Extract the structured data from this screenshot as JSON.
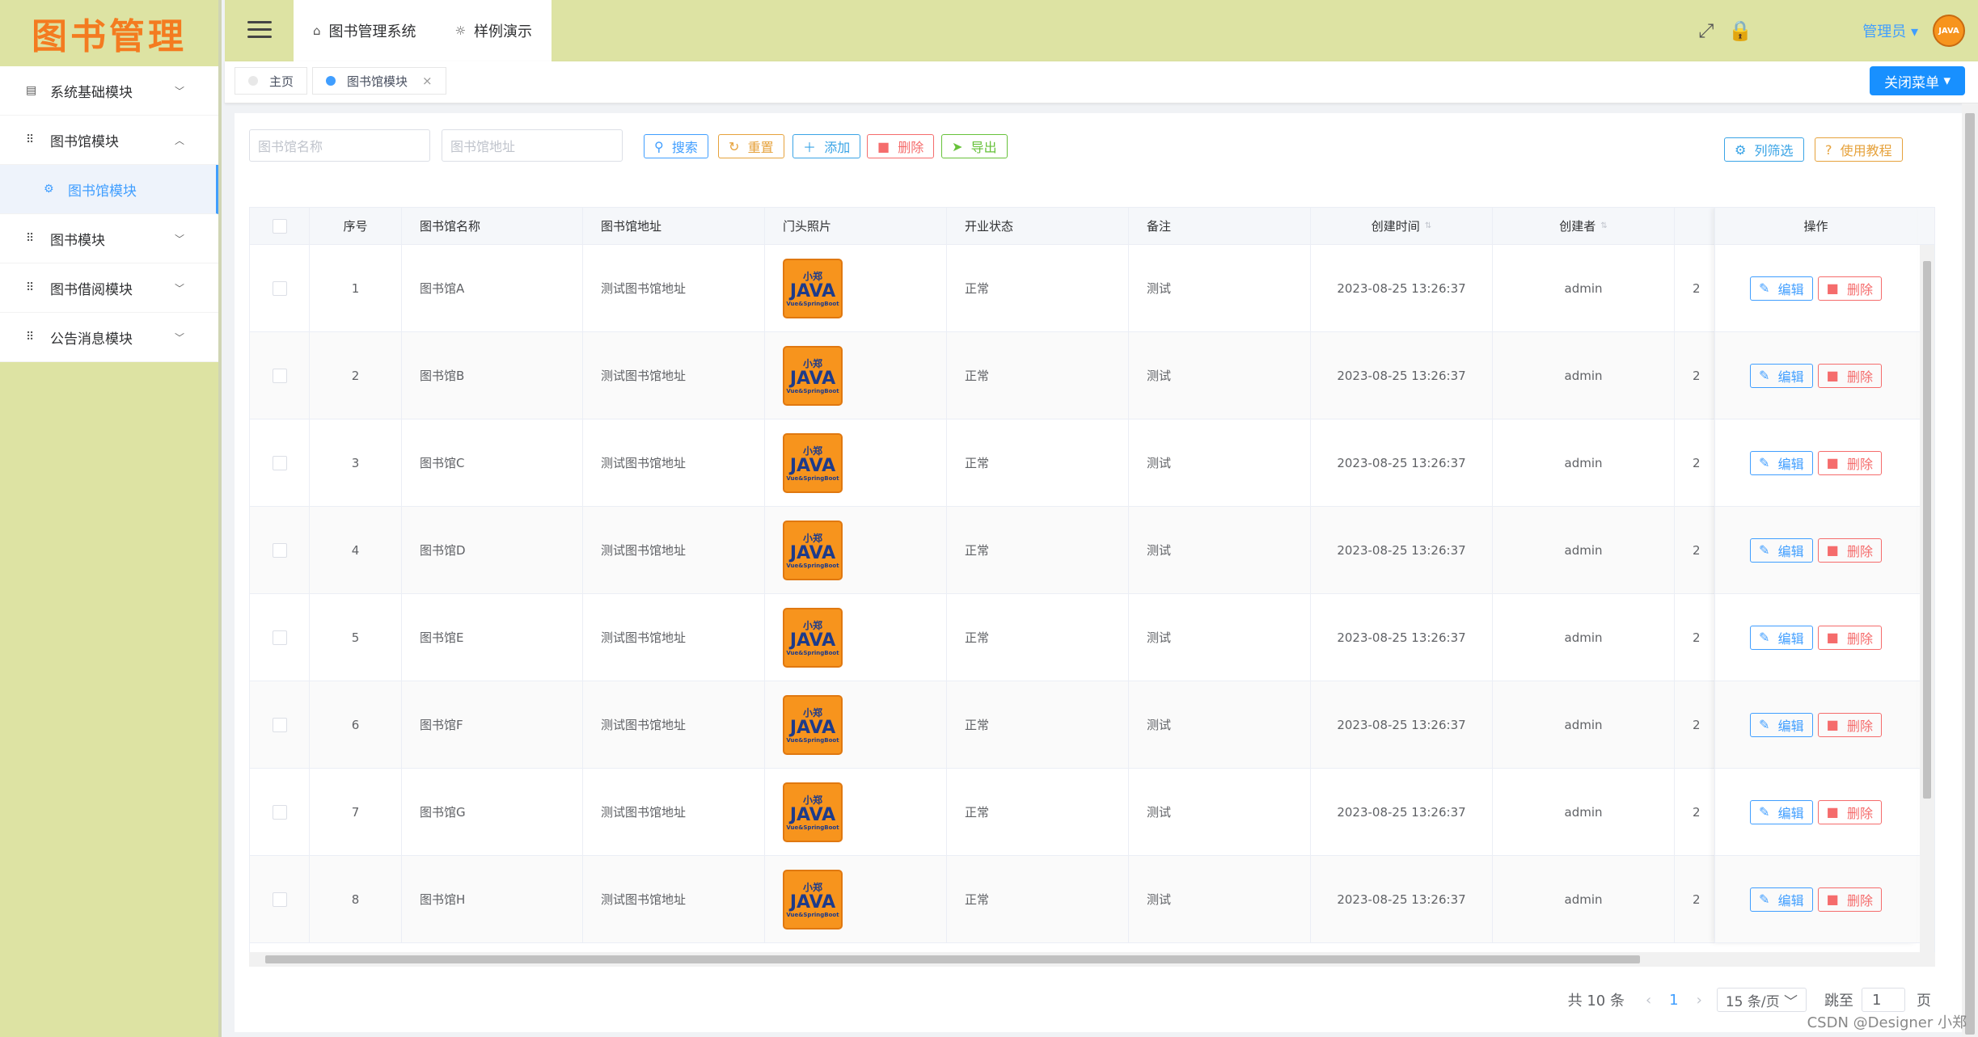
{
  "sidebar": {
    "logo": "图书管理",
    "menu": [
      {
        "label": "系统基础模块",
        "icon": "chart-icon",
        "expanded": false
      },
      {
        "label": "图书馆模块",
        "icon": "grid-icon",
        "expanded": true
      },
      {
        "label": "图书馆模块",
        "icon": "settings-icon",
        "submenu": true
      },
      {
        "label": "图书模块",
        "icon": "grid-icon",
        "expanded": false
      },
      {
        "label": "图书借阅模块",
        "icon": "grid-icon",
        "expanded": false
      },
      {
        "label": "公告消息模块",
        "icon": "grid-icon",
        "expanded": false
      }
    ]
  },
  "header": {
    "tabs": [
      {
        "label": "图书管理系统",
        "icon": "home-icon"
      },
      {
        "label": "样例演示",
        "icon": "sun-icon"
      }
    ],
    "user": "管理员"
  },
  "tags": {
    "items": [
      {
        "label": "主页"
      },
      {
        "label": "图书馆模块",
        "close": "×"
      }
    ],
    "close_menu": "关闭菜单"
  },
  "toolbar": {
    "name_placeholder": "图书馆名称",
    "address_placeholder": "图书馆地址",
    "search": "搜索",
    "reset": "重置",
    "add": "添加",
    "delete": "删除",
    "export": "导出",
    "columns": "列筛选",
    "tutorial": "使用教程"
  },
  "table": {
    "headers": [
      "序号",
      "图书馆名称",
      "图书馆地址",
      "门头照片",
      "开业状态",
      "备注",
      "创建时间",
      "创建者",
      "操作"
    ],
    "rows": [
      {
        "no": "1",
        "name": "图书馆A",
        "address": "测试图书馆地址",
        "status": "正常",
        "remark": "测试",
        "created": "2023-08-25 13:26:37",
        "creator": "admin",
        "extra": "2"
      },
      {
        "no": "2",
        "name": "图书馆B",
        "address": "测试图书馆地址",
        "status": "正常",
        "remark": "测试",
        "created": "2023-08-25 13:26:37",
        "creator": "admin",
        "extra": "2"
      },
      {
        "no": "3",
        "name": "图书馆C",
        "address": "测试图书馆地址",
        "status": "正常",
        "remark": "测试",
        "created": "2023-08-25 13:26:37",
        "creator": "admin",
        "extra": "2"
      },
      {
        "no": "4",
        "name": "图书馆D",
        "address": "测试图书馆地址",
        "status": "正常",
        "remark": "测试",
        "created": "2023-08-25 13:26:37",
        "creator": "admin",
        "extra": "2"
      },
      {
        "no": "5",
        "name": "图书馆E",
        "address": "测试图书馆地址",
        "status": "正常",
        "remark": "测试",
        "created": "2023-08-25 13:26:37",
        "creator": "admin",
        "extra": "2"
      },
      {
        "no": "6",
        "name": "图书馆F",
        "address": "测试图书馆地址",
        "status": "正常",
        "remark": "测试",
        "created": "2023-08-25 13:26:37",
        "creator": "admin",
        "extra": "2"
      },
      {
        "no": "7",
        "name": "图书馆G",
        "address": "测试图书馆地址",
        "status": "正常",
        "remark": "测试",
        "created": "2023-08-25 13:26:37",
        "creator": "admin",
        "extra": "2"
      },
      {
        "no": "8",
        "name": "图书馆H",
        "address": "测试图书馆地址",
        "status": "正常",
        "remark": "测试",
        "created": "2023-08-25 13:26:37",
        "creator": "admin",
        "extra": "2"
      }
    ],
    "edit": "编辑",
    "delete": "删除",
    "thumb": {
      "line1": "小郑",
      "line2": "JAVA",
      "line3": "Vue&SpringBoot"
    }
  },
  "pagination": {
    "total": "共 10 条",
    "current": "1",
    "page_size": "15 条/页",
    "goto": "跳至",
    "goto_value": "1",
    "page_unit": "页"
  },
  "watermark": "CSDN @Designer 小郑"
}
